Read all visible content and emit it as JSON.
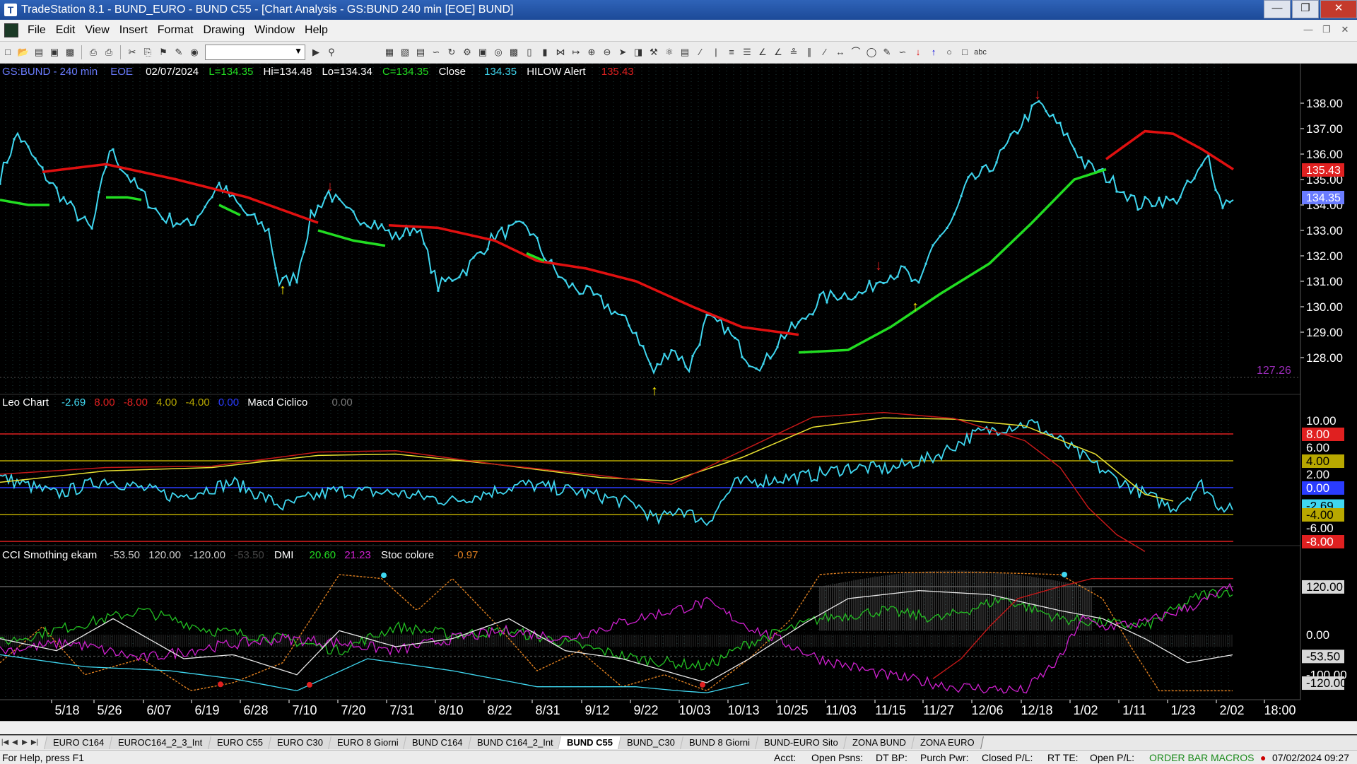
{
  "window": {
    "title": "TradeStation 8.1 - BUND_EURO - BUND C55 - [Chart Analysis - GS:BUND  240 min  [EOE] BUND]"
  },
  "menu": [
    "File",
    "Edit",
    "View",
    "Insert",
    "Format",
    "Drawing",
    "Window",
    "Help"
  ],
  "price_header": {
    "symbol": "GS:BUND - 240 min",
    "exchange": "EOE",
    "date": "02/07/2024",
    "low_label": "L=134.35",
    "high_label": "Hi=134.48",
    "lo_label": "Lo=134.34",
    "close_label": "C=134.35",
    "close_word": "Close",
    "close_value": "134.35",
    "hilow_label": "HILOW Alert",
    "hilow_value": "135.43"
  },
  "macd_header": {
    "name": "Leo Chart",
    "v1": "-2.69",
    "v2": "8.00",
    "v3": "-8.00",
    "v4": "4.00",
    "v5": "-4.00",
    "v6": "0.00",
    "name2": "Macd Ciclico",
    "v7": "0.00"
  },
  "cci_header": {
    "name": "CCI Smothing ekam",
    "v1": "-53.50",
    "v2": "120.00",
    "v3": "-120.00",
    "v4": "-53.50",
    "dmi": "DMI",
    "dmi1": "20.60",
    "dmi2": "21.23",
    "stoc": "Stoc colore",
    "stoc_v": "-0.97"
  },
  "price_axis": [
    "138.00",
    "137.00",
    "136.00",
    "135.00",
    "134.00",
    "133.00",
    "132.00",
    "131.00",
    "130.00",
    "129.00",
    "128.00"
  ],
  "price_badges": {
    "hilow": "135.43",
    "last": "134.35",
    "low_marker": "127.26"
  },
  "macd_axis": [
    "10.00",
    "6.00",
    "2.00",
    "-6.00"
  ],
  "macd_badges": [
    "8.00",
    "4.00",
    "0.00",
    "-2.69",
    "-4.00",
    "-8.00"
  ],
  "cci_axis": [
    "0.00",
    "-100.00"
  ],
  "cci_badges": [
    "120.00",
    "-53.50",
    "-120.00"
  ],
  "date_axis": [
    "5/18",
    "5/26",
    "6/07",
    "6/19",
    "6/28",
    "7/10",
    "7/20",
    "7/31",
    "8/10",
    "8/22",
    "8/31",
    "9/12",
    "9/22",
    "10/03",
    "10/13",
    "10/25",
    "11/03",
    "11/15",
    "11/27",
    "12/06",
    "12/18",
    "1/02",
    "1/11",
    "1/23",
    "2/02",
    "18:00"
  ],
  "tabs": [
    "EURO C164",
    "EUROC164_2_3_Int",
    "EURO C55",
    "EURO C30",
    "EURO 8 Giorni",
    "BUND C164",
    "BUND C164_2_Int",
    "BUND C55",
    "BUND_C30",
    "BUND 8 Giorni",
    "BUND-EURO Sito",
    "ZONA BUND",
    "ZONA EURO"
  ],
  "active_tab": "BUND C55",
  "status": {
    "help": "For Help, press F1",
    "acct": "Acct:",
    "open_psns": "Open Psns:",
    "dt_bp": "DT BP:",
    "purch_pwr": "Purch Pwr:",
    "closed_pl": "Closed P/L:",
    "rt_te": "RT TE:",
    "open_pl": "Open P/L:",
    "order_bar": "ORDER BAR",
    "macros": "MACROS",
    "datetime": "07/02/2024 09:27"
  },
  "colors": {
    "price_line": "#3fd7f0",
    "red_ma": "#e01010",
    "green_ma": "#22dd22",
    "bg": "#000000",
    "axis_text": "#ffffff",
    "alert_red": "#e02020",
    "last_blue": "#6a7cff"
  }
}
